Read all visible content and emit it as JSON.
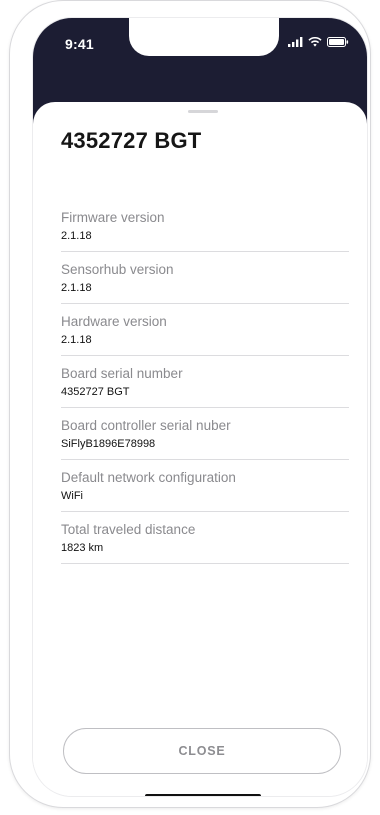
{
  "status_bar": {
    "time": "9:41",
    "icons": [
      "signal-icon",
      "wifi-icon",
      "battery-icon"
    ]
  },
  "sheet": {
    "title": "4352727 BGT",
    "fields": [
      {
        "label": "Firmware version",
        "value": "2.1.18"
      },
      {
        "label": "Sensorhub version",
        "value": "2.1.18"
      },
      {
        "label": "Hardware version",
        "value": "2.1.18"
      },
      {
        "label": "Board serial number",
        "value": "4352727 BGT"
      },
      {
        "label": "Board controller serial nuber",
        "value": "SiFlyB1896E78998"
      },
      {
        "label": "Default network configuration",
        "value": "WiFi"
      },
      {
        "label": "Total traveled distance",
        "value": "1823 km"
      }
    ],
    "close_label": "CLOSE"
  },
  "colors": {
    "header_background": "#1c1d33",
    "label_gray": "#8a8a8e",
    "value_black": "#111111"
  }
}
